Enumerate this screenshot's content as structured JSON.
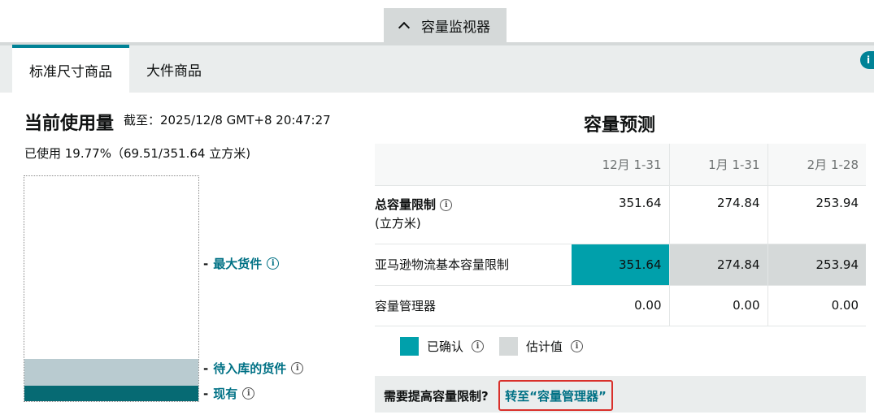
{
  "monitor_toggle": {
    "label": "容量监视器",
    "icon": "chevron-up-icon"
  },
  "tabs": [
    {
      "label": "标准尺寸商品",
      "active": true
    },
    {
      "label": "大件商品",
      "active": false
    }
  ],
  "current_usage": {
    "title": "当前使用量",
    "as_of": "截至：2025/12/8 GMT+8 20:47:27",
    "summary": "已使用 19.77%（69.51/351.64 立方米)",
    "max_inventory_label": "最大货件",
    "inbound_label": "待入库的货件",
    "on_hand_label": "现有",
    "inbound_fraction": 0.12,
    "on_hand_fraction": 0.07,
    "inbound_color": "#b9cbd0",
    "on_hand_color": "#066a73"
  },
  "forecast": {
    "title": "容量预测",
    "columns": [
      "12月 1-31",
      "1月 1-31",
      "2月 1-28"
    ],
    "rows": [
      {
        "label": "总容量限制",
        "sublabel": "(立方米)",
        "values": [
          "351.64",
          "274.84",
          "253.94"
        ]
      },
      {
        "label": "亚马逊物流基本容量限制",
        "values": [
          "351.64",
          "274.84",
          "253.94"
        ]
      },
      {
        "label": "容量管理器",
        "values": [
          "0.00",
          "0.00",
          "0.00"
        ]
      }
    ],
    "legend": {
      "confirmed": "已确认",
      "estimated": "估计值",
      "confirmed_color": "#00a0ab",
      "estimated_color": "#d5d9d9"
    }
  },
  "cta": {
    "question": "需要提高容量限制?",
    "link": "转至“容量管理器”"
  }
}
